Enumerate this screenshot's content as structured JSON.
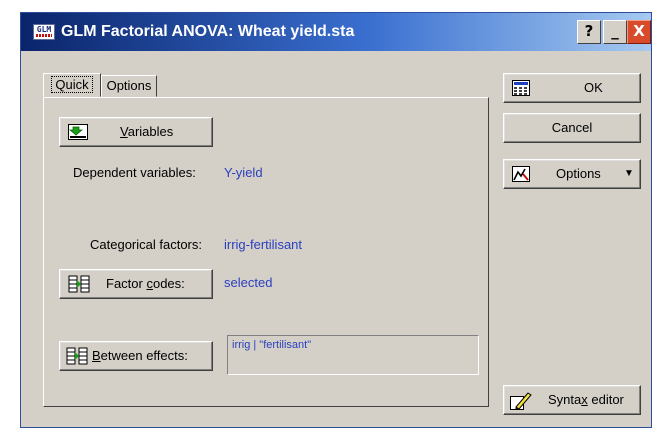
{
  "window": {
    "title": "GLM Factorial ANOVA: Wheat yield.sta",
    "app_icon_text": "GLM",
    "help_label": "?",
    "minimize_label": "_",
    "close_label": "X"
  },
  "tabs": [
    {
      "label": "Quick",
      "active": true
    },
    {
      "label": "Options",
      "active": false
    }
  ],
  "quick": {
    "variables_button": {
      "pre": "",
      "u": "V",
      "post": "ariables"
    },
    "dependent_label": "Dependent variables:",
    "dependent_value": "Y-yield",
    "categorical_label": "Categorical factors:",
    "categorical_value": "irrig-fertilisant",
    "factor_codes_button": {
      "pre": "Factor ",
      "u": "c",
      "post": "odes:"
    },
    "factor_codes_value": "selected",
    "between_effects_button": {
      "pre": "",
      "u": "B",
      "post": "etween effects:"
    },
    "between_effects_value": "irrig | \"fertilisant\""
  },
  "side": {
    "ok_label": "OK",
    "cancel_label": "Cancel",
    "options_label": "Options",
    "options_arrow": "▼",
    "syntax_pre": "Synta",
    "syntax_u": "x",
    "syntax_post": " editor"
  }
}
